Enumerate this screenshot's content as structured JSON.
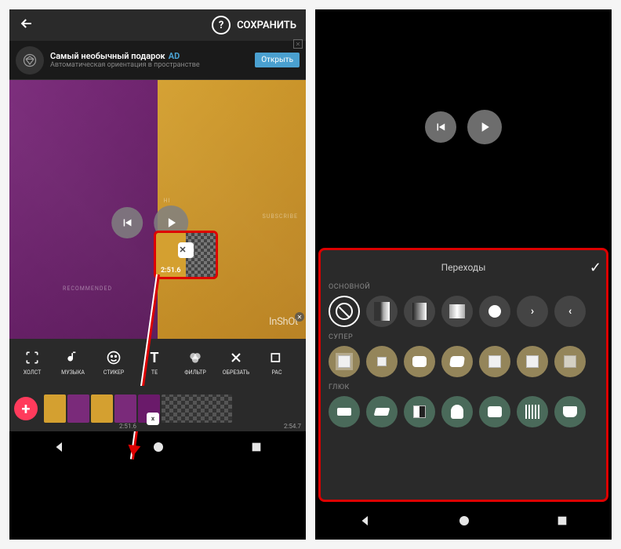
{
  "header": {
    "save": "СОХРАНИТЬ"
  },
  "ad": {
    "title": "Самый необычный подарок",
    "label": "AD",
    "subtitle": "Автоматическая ориентация в пространстве",
    "cta": "Открыть"
  },
  "watermark": "InShOt",
  "preview_text": {
    "hi": "HI",
    "recommended": "RECOMMENDED",
    "subscribe": "SUBSCRIBE"
  },
  "toolbar": [
    {
      "label": "ХОЛСТ",
      "icon": "canvas"
    },
    {
      "label": "МУЗЫКА",
      "icon": "music"
    },
    {
      "label": "СТИКЕР",
      "icon": "sticker"
    },
    {
      "label": "ТЕ",
      "icon": "text"
    },
    {
      "label": "ФИЛЬТР",
      "icon": "filter"
    },
    {
      "label": "ОБРЕЗАТЬ",
      "icon": "crop"
    },
    {
      "label": "РАС",
      "icon": "more"
    }
  ],
  "timeline": {
    "callout_time": "2:51.6",
    "handle_time": "2:51.6",
    "end_time": "2:54.7"
  },
  "transitions": {
    "title": "Переходы",
    "sections": {
      "basic": "ОСНОВНОЙ",
      "super": "СУПЕР",
      "glitch": "ГЛЮК"
    }
  }
}
